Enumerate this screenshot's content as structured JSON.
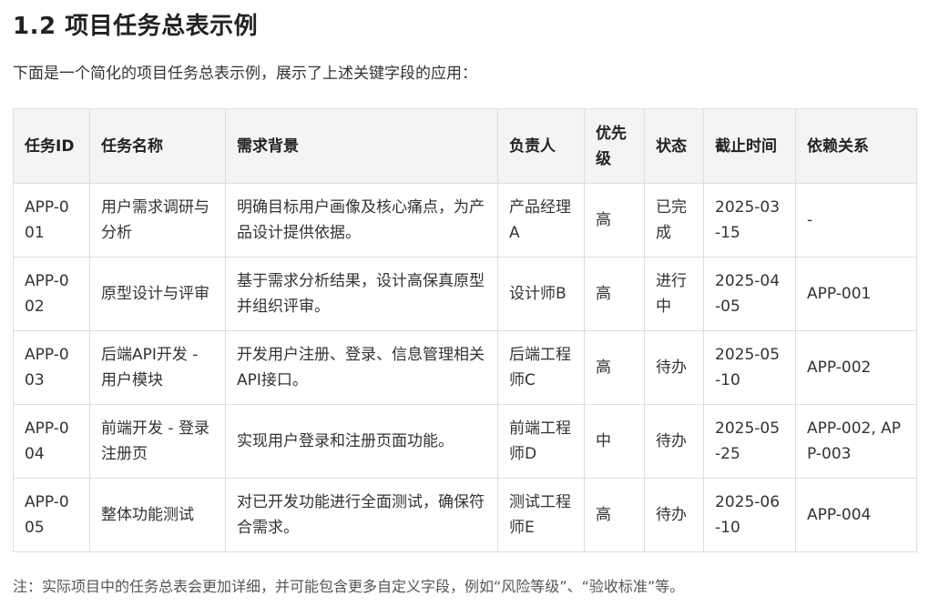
{
  "section": {
    "title": "1.2 项目任务总表示例",
    "intro": "下面是一个简化的项目任务总表示例，展示了上述关键字段的应用："
  },
  "table": {
    "headers": [
      "任务ID",
      "任务名称",
      "需求背景",
      "负责人",
      "优先级",
      "状态",
      "截止时间",
      "依赖关系"
    ],
    "rows": [
      [
        "APP-001",
        "用户需求调研与分析",
        "明确目标用户画像及核心痛点，为产品设计提供依据。",
        "产品经理A",
        "高",
        "已完成",
        "2025-03-15",
        "-"
      ],
      [
        "APP-002",
        "原型设计与评审",
        "基于需求分析结果，设计高保真原型并组织评审。",
        "设计师B",
        "高",
        "进行中",
        "2025-04-05",
        "APP-001"
      ],
      [
        "APP-003",
        "后端API开发 - 用户模块",
        "开发用户注册、登录、信息管理相关API接口。",
        "后端工程师C",
        "高",
        "待办",
        "2025-05-10",
        "APP-002"
      ],
      [
        "APP-004",
        "前端开发 - 登录注册页",
        "实现用户登录和注册页面功能。",
        "前端工程师D",
        "中",
        "待办",
        "2025-05-25",
        "APP-002, APP-003"
      ],
      [
        "APP-005",
        "整体功能测试",
        "对已开发功能进行全面测试，确保符合需求。",
        "测试工程师E",
        "高",
        "待办",
        "2025-06-10",
        "APP-004"
      ]
    ]
  },
  "note": "注：实际项目中的任务总表会更加详细，并可能包含更多自定义字段，例如“风险等级”、“验收标准”等。"
}
